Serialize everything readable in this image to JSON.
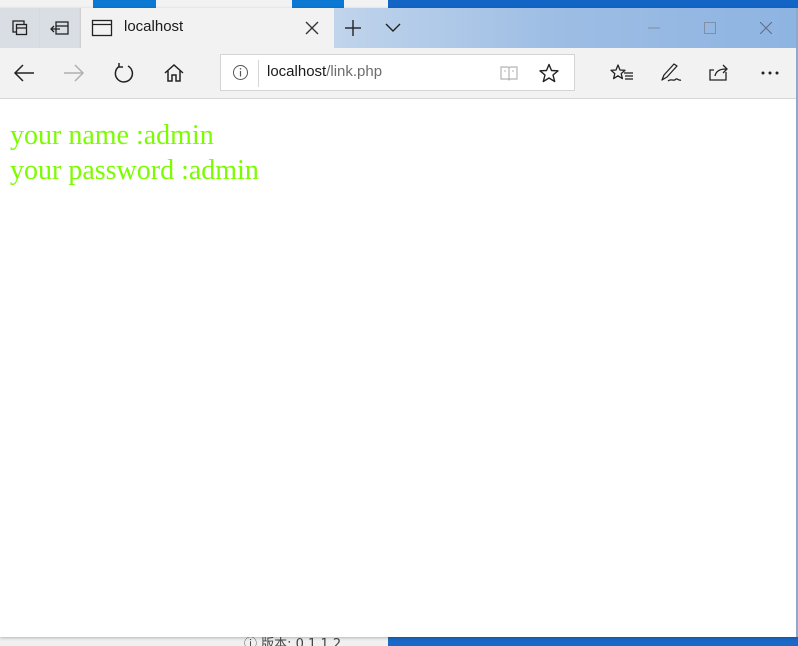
{
  "browser": {
    "tab_title": "localhost",
    "address": {
      "host": "localhost",
      "path": "/link.php"
    }
  },
  "background": {
    "partial_text": "ⓘ 版本: 0.1.1.2"
  },
  "page": {
    "lines": [
      "your name :admin",
      "your password :admin"
    ],
    "text_color": "#7cfc00"
  },
  "icons": {
    "tab_controls": [
      "set-aside-tabs-icon",
      "tab-preview-icon"
    ],
    "tab": [
      "page-icon",
      "close-icon"
    ],
    "tabbar": [
      "new-tab-icon",
      "tab-list-chevron-icon"
    ],
    "window": [
      "minimize-icon",
      "maximize-icon",
      "close-window-icon"
    ],
    "nav": [
      "back-arrow-icon",
      "forward-arrow-icon",
      "refresh-icon",
      "home-icon"
    ],
    "address": [
      "info-icon",
      "reading-view-icon",
      "favorite-star-icon"
    ],
    "toolbar": [
      "favorites-list-icon",
      "pen-icon",
      "share-icon",
      "more-icon"
    ]
  }
}
